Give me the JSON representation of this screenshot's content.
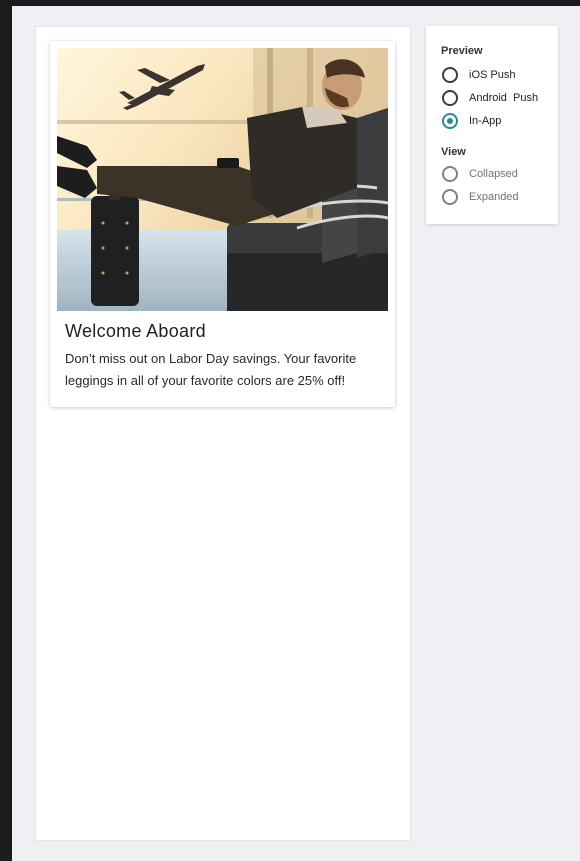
{
  "preview_card": {
    "title": "Welcome Aboard",
    "body": "Don’t miss out on Labor Day savings. Your favorite leggings in all of your favorite colors are 25% off!",
    "image": "airport-traveler-photo"
  },
  "options": {
    "preview_label": "Preview",
    "preview_items": [
      {
        "label": "iOS Push",
        "checked": false
      },
      {
        "label": "Android  Push",
        "checked": false
      },
      {
        "label": "In-App",
        "checked": true
      }
    ],
    "view_label": "View",
    "view_items": [
      {
        "label": "Collapsed",
        "checked": false,
        "disabled": true
      },
      {
        "label": "Expanded",
        "checked": false,
        "disabled": true
      }
    ]
  },
  "colors": {
    "accent": "#2a8d86",
    "panel": "#ffffff",
    "background": "#f0f0f4"
  }
}
